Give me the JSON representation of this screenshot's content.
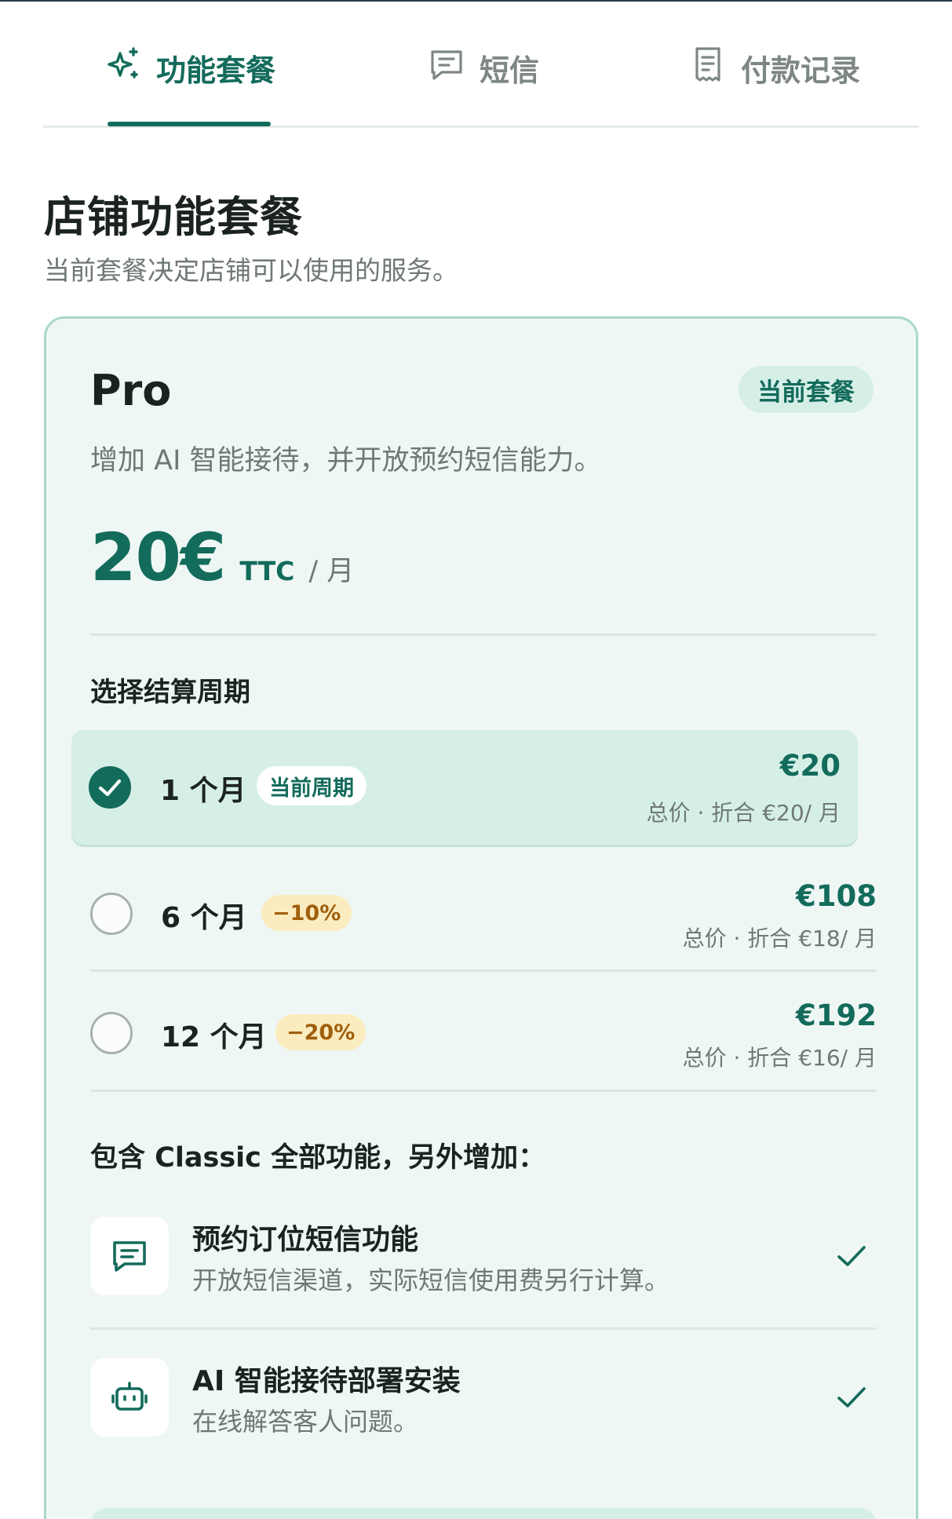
{
  "tabs": [
    {
      "label": "功能套餐",
      "icon": "sparkle-icon",
      "active": true
    },
    {
      "label": "短信",
      "icon": "message-icon",
      "active": false
    },
    {
      "label": "付款记录",
      "icon": "receipt-icon",
      "active": false
    }
  ],
  "header": {
    "title": "店铺功能套餐",
    "subtitle": "当前套餐决定店铺可以使用的服务。"
  },
  "plan": {
    "name": "Pro",
    "badge": "当前套餐",
    "description": "增加 AI 智能接待，并开放预约短信能力。",
    "price": "20€",
    "price_tax": "TTC",
    "price_period": "/ 月"
  },
  "billing": {
    "label": "选择结算周期",
    "options": [
      {
        "label": "1 个月",
        "tag": "当前周期",
        "tag_type": "current",
        "price": "€20",
        "note": "总价 · 折合 €20/ 月",
        "selected": true
      },
      {
        "label": "6 个月",
        "tag": "−10%",
        "tag_type": "discount",
        "price": "€108",
        "note": "总价 · 折合 €18/ 月",
        "selected": false
      },
      {
        "label": "12 个月",
        "tag": "−20%",
        "tag_type": "discount",
        "price": "€192",
        "note": "总价 · 折合 €16/ 月",
        "selected": false
      }
    ]
  },
  "features": {
    "title": "包含 Classic 全部功能，另外增加：",
    "items": [
      {
        "title": "预约订位短信功能",
        "description": "开放短信渠道，实际短信使用费另行计算。",
        "icon": "message-icon",
        "included": true
      },
      {
        "title": "AI 智能接待部署安装",
        "description": "在线解答客人问题。",
        "icon": "robot-icon",
        "included": true
      }
    ]
  },
  "colors": {
    "accent": "#136b5b",
    "card_bg": "#eff7f4",
    "card_border": "#a9d7cb",
    "selected_bg": "#d5efe7",
    "discount_bg": "#fbecc0",
    "discount_text": "#a05f0d"
  }
}
